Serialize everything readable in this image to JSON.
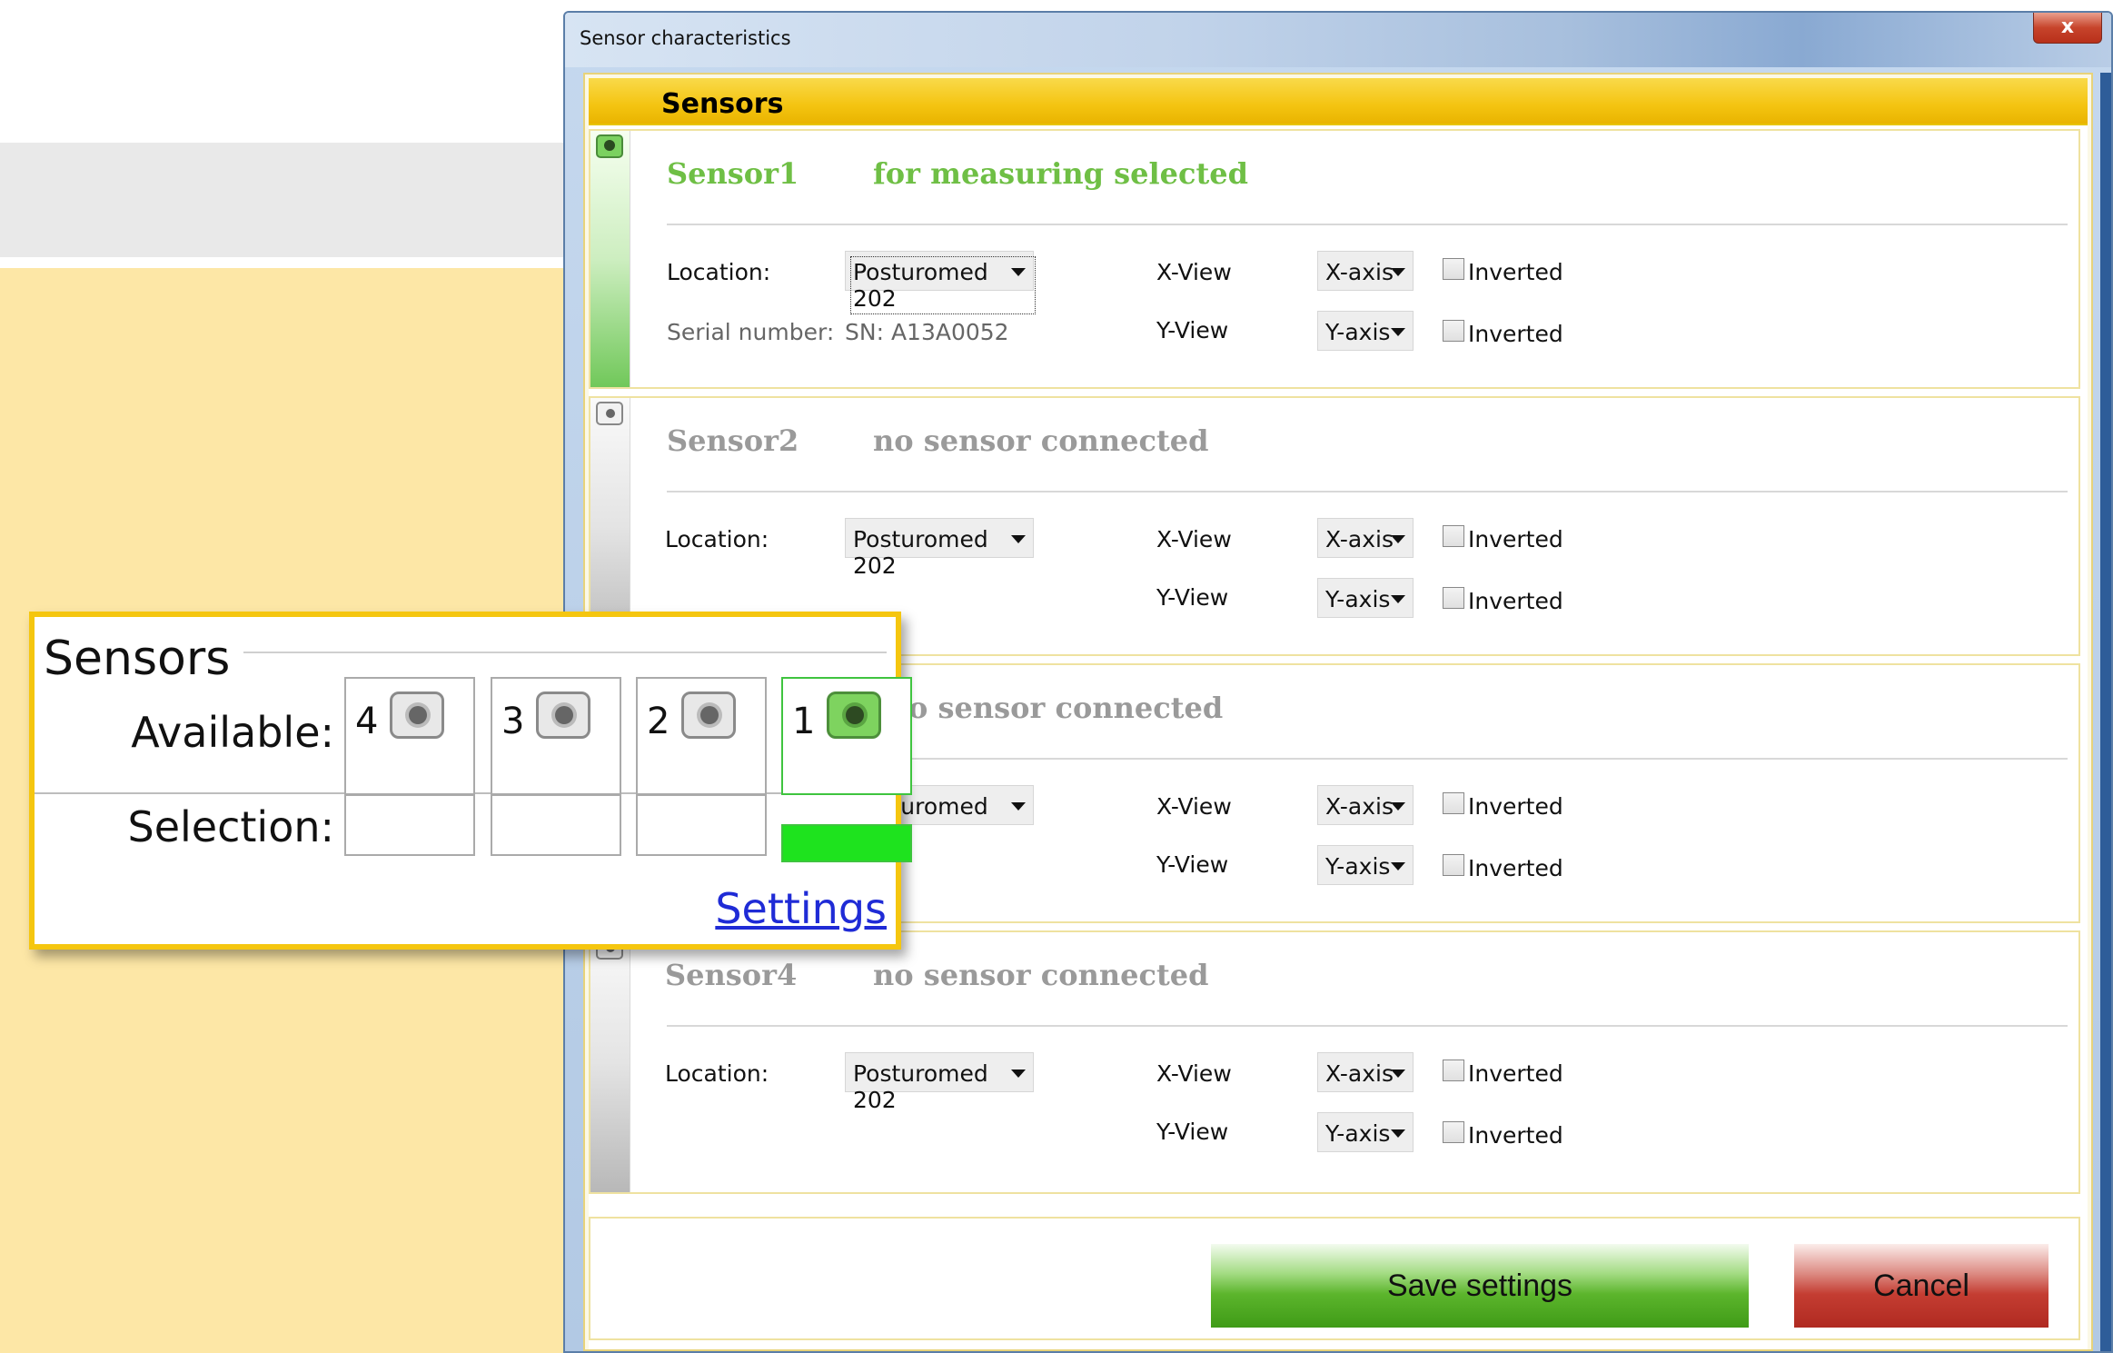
{
  "window": {
    "title": "Sensor characteristics",
    "close_label": "x"
  },
  "section": {
    "title": "Sensors"
  },
  "sensors": [
    {
      "name": "Sensor1",
      "status": "for measuring selected",
      "location_label": "Location:",
      "location_value": "Posturomed 202",
      "serial_label": "Serial number:",
      "serial_value": "SN: A13A0052",
      "xview_label": "X-View",
      "xview_value": "X-axis",
      "yview_label": "Y-View",
      "yview_value": "Y-axis",
      "inverted_x_label": "Inverted",
      "inverted_y_label": "Inverted"
    },
    {
      "name": "Sensor2",
      "status": "no sensor connected",
      "location_label": "Location:",
      "location_value": "Posturomed 202",
      "xview_label": "X-View",
      "xview_value": "X-axis",
      "yview_label": "Y-View",
      "yview_value": "Y-axis",
      "inverted_x_label": "Inverted",
      "inverted_y_label": "Inverted"
    },
    {
      "status": "o sensor connected",
      "location_value": "Posturomed 202",
      "xview_label": "X-View",
      "xview_value": "X-axis",
      "yview_label": "Y-View",
      "yview_value": "Y-axis",
      "inverted_x_label": "Inverted",
      "inverted_y_label": "Inverted"
    },
    {
      "name": "Sensor4",
      "status": "no sensor connected",
      "location_label": "Location:",
      "location_value": "Posturomed 202",
      "xview_label": "X-View",
      "xview_value": "X-axis",
      "yview_label": "Y-View",
      "yview_value": "Y-axis",
      "inverted_x_label": "Inverted",
      "inverted_y_label": "Inverted"
    }
  ],
  "footer": {
    "save_label": "Save settings",
    "cancel_label": "Cancel"
  },
  "inset": {
    "title": "Sensors",
    "available_label": "Available:",
    "selection_label": "Selection:",
    "slots": [
      "4",
      "3",
      "2",
      "1"
    ],
    "settings_link": "Settings"
  },
  "colors": {
    "header_yellow": "#f4c411",
    "selected_green": "#6fbf45",
    "inactive_gray": "#9a9a9a",
    "save_green": "#5cb52c",
    "cancel_red": "#c43d32",
    "selection_green": "#1ee31e",
    "link_blue": "#1f2bd6"
  }
}
